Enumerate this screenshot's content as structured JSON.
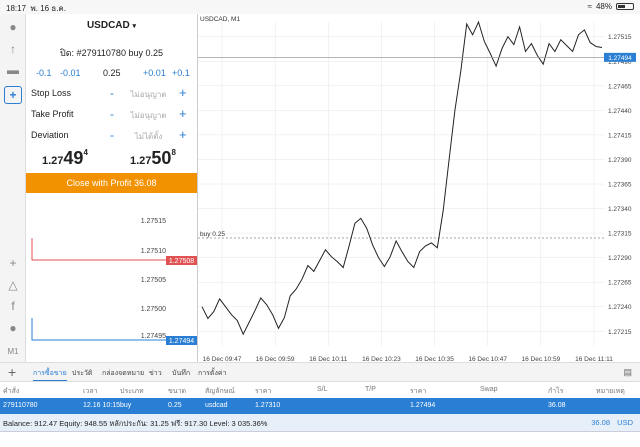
{
  "status_bar": {
    "time": "18:17",
    "date": "พ. 16 ธ.ค.",
    "battery": "48%"
  },
  "sidebar_icons": [
    {
      "name": "quotes-icon",
      "glyph": "●"
    },
    {
      "name": "charts-icon",
      "glyph": "↑"
    },
    {
      "name": "chat-icon",
      "glyph": "▬"
    },
    {
      "name": "new-order-icon",
      "glyph": "+"
    },
    {
      "name": "crosshair-icon",
      "glyph": "+"
    },
    {
      "name": "drawing-icon",
      "glyph": "△"
    },
    {
      "name": "indicators-icon",
      "glyph": "f"
    },
    {
      "name": "objects-icon",
      "glyph": "●"
    },
    {
      "name": "timeframe-icon",
      "glyph": "M1"
    }
  ],
  "order_panel": {
    "symbol": "USDCAD",
    "dropdown_glyph": "▾",
    "order_line": "ปิด: #279110780 buy 0.25",
    "volume": {
      "m1": "-0.1",
      "m2": "-0.01",
      "current": "0.25",
      "p1": "+0.01",
      "p2": "+0.1"
    },
    "stop_loss": {
      "label": "Stop Loss",
      "value": "ไม่อนุญาต"
    },
    "take_profit": {
      "label": "Take Profit",
      "value": "ไม่อนุญาต"
    },
    "deviation": {
      "label": "Deviation",
      "value": "ไม่ได้ตั้ง"
    },
    "minus": "-",
    "plus": "+",
    "bid": {
      "a": "1.27",
      "b": "49",
      "c": "4"
    },
    "ask": {
      "a": "1.27",
      "b": "50",
      "c": "8"
    },
    "close_button": "Close with Profit 36.08"
  },
  "ladder": {
    "labels": [
      "1.27515",
      "1.27510",
      "1.27505",
      "1.27500",
      "1.27495"
    ],
    "ask_badge": "1.27508",
    "bid_badge": "1.27494",
    "colors": {
      "ask": "#e05252",
      "bid": "#2a7fd4"
    }
  },
  "chart_data": {
    "type": "line",
    "title": "USDCAD, M1",
    "y_ticks": [
      "1.27515",
      "1.27490",
      "1.27465",
      "1.27440",
      "1.27415",
      "1.27390",
      "1.27365",
      "1.27340",
      "1.27315",
      "1.27290",
      "1.27265",
      "1.27240",
      "1.27215"
    ],
    "x_ticks": [
      "16 Dec 09:47",
      "16 Dec 09:59",
      "16 Dec 10:11",
      "16 Dec 10:23",
      "16 Dec 10:35",
      "16 Dec 10:47",
      "16 Dec 10:59",
      "16 Dec 11:11"
    ],
    "ylim": [
      1.272,
      1.2753
    ],
    "y": [
      1.2724,
      1.27228,
      1.27235,
      1.27248,
      1.2724,
      1.27232,
      1.27226,
      1.27212,
      1.27224,
      1.27236,
      1.27249,
      1.27242,
      1.27232,
      1.27218,
      1.27229,
      1.27251,
      1.27258,
      1.27268,
      1.27282,
      1.27276,
      1.27287,
      1.27298,
      1.27291,
      1.27286,
      1.2728,
      1.27302,
      1.27325,
      1.2733,
      1.2732,
      1.27303,
      1.2729,
      1.27281,
      1.27291,
      1.27307,
      1.27296,
      1.27286,
      1.2728,
      1.27296,
      1.27302,
      1.27305,
      1.273,
      1.27338,
      1.2739,
      1.2744,
      1.2748,
      1.27528,
      1.27517,
      1.2753,
      1.2751,
      1.27498,
      1.27485,
      1.27503,
      1.27515,
      1.27507,
      1.27525,
      1.275,
      1.27508,
      1.27496,
      1.27487,
      1.27508,
      1.275,
      1.27512,
      1.27506,
      1.275,
      1.27517,
      1.27522,
      1.27509,
      1.27505,
      1.27504
    ],
    "bid_line": 1.27494,
    "bid_badge": "1.27494",
    "buy_line": 1.2731,
    "buy_label": "buy 0.25",
    "colors": {
      "line": "#222222",
      "badge": "#2a7fd4",
      "grid": "#e6e6e6"
    }
  },
  "tabs": [
    "การซื้อขาย",
    "ประวัติ",
    "กล่องจดหมาย",
    "ข่าว",
    "บันทึก",
    "การตั้งค่า"
  ],
  "table": {
    "headers": [
      "คำสั่ง",
      "เวลา",
      "ประเภท",
      "ขนาด",
      "สัญลักษณ์",
      "ราคา",
      "S/L",
      "T/P",
      "ราคา",
      "Swap",
      "กำไร",
      "หมายเหตุ"
    ],
    "row": [
      "279110780",
      "12.16 10:15",
      "buy",
      "0.25",
      "usdcad",
      "1.27310",
      "",
      "",
      "1.27494",
      "",
      "36.08",
      ""
    ]
  },
  "summary": {
    "text": "Balance: 912.47 Equity: 948.55 หลักประกัน: 31.25 ฟรี: 917.30 Level: 3 035.36%",
    "profit": "36.08",
    "currency": "USD"
  }
}
